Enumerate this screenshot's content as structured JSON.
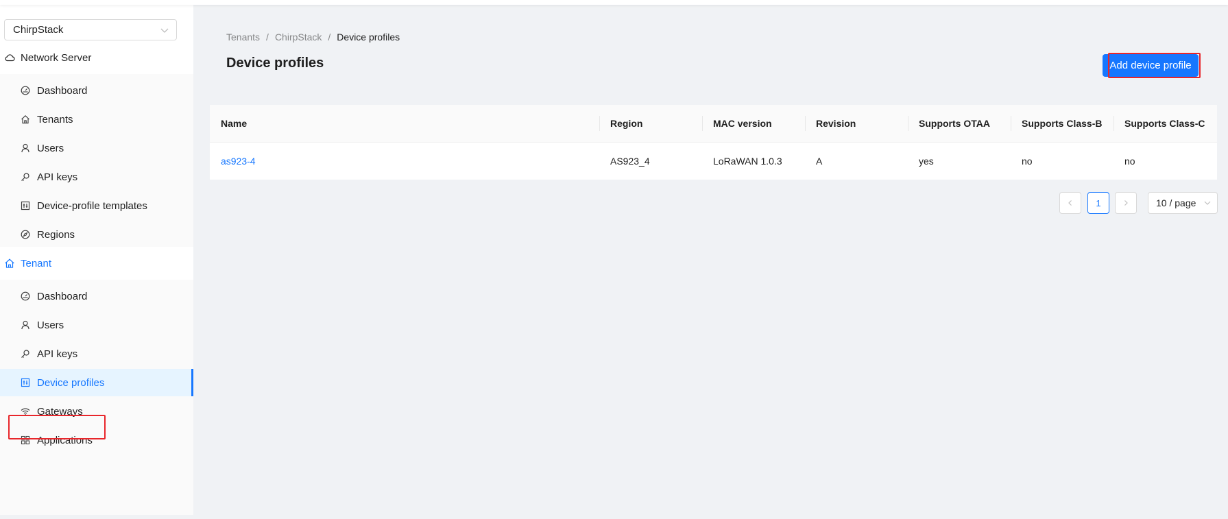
{
  "tenant_select": {
    "value": "ChirpStack"
  },
  "menu": {
    "network_server": {
      "label": "Network Server",
      "items": [
        {
          "label": "Dashboard",
          "icon": "dashboard-icon"
        },
        {
          "label": "Tenants",
          "icon": "home-icon"
        },
        {
          "label": "Users",
          "icon": "user-icon"
        },
        {
          "label": "API keys",
          "icon": "key-icon"
        },
        {
          "label": "Device-profile templates",
          "icon": "control-icon"
        },
        {
          "label": "Regions",
          "icon": "compass-icon"
        }
      ]
    },
    "tenant": {
      "label": "Tenant",
      "items": [
        {
          "label": "Dashboard",
          "icon": "dashboard-icon"
        },
        {
          "label": "Users",
          "icon": "user-icon"
        },
        {
          "label": "API keys",
          "icon": "key-icon"
        },
        {
          "label": "Device profiles",
          "icon": "control-icon",
          "selected": true
        },
        {
          "label": "Gateways",
          "icon": "wifi-icon"
        },
        {
          "label": "Applications",
          "icon": "appstore-icon"
        }
      ]
    }
  },
  "breadcrumb": [
    "Tenants",
    "ChirpStack",
    "Device profiles"
  ],
  "page": {
    "title": "Device profiles",
    "add_button": "Add device profile"
  },
  "table": {
    "columns": [
      "Name",
      "Region",
      "MAC version",
      "Revision",
      "Supports OTAA",
      "Supports Class-B",
      "Supports Class-C"
    ],
    "rows": [
      [
        "as923-4",
        "AS923_4",
        "LoRaWAN 1.0.3",
        "A",
        "yes",
        "no",
        "no"
      ]
    ]
  },
  "pagination": {
    "current_page": "1",
    "page_size": "10 / page"
  },
  "colors": {
    "accent": "#1677ff",
    "highlight": "#e8262b"
  }
}
